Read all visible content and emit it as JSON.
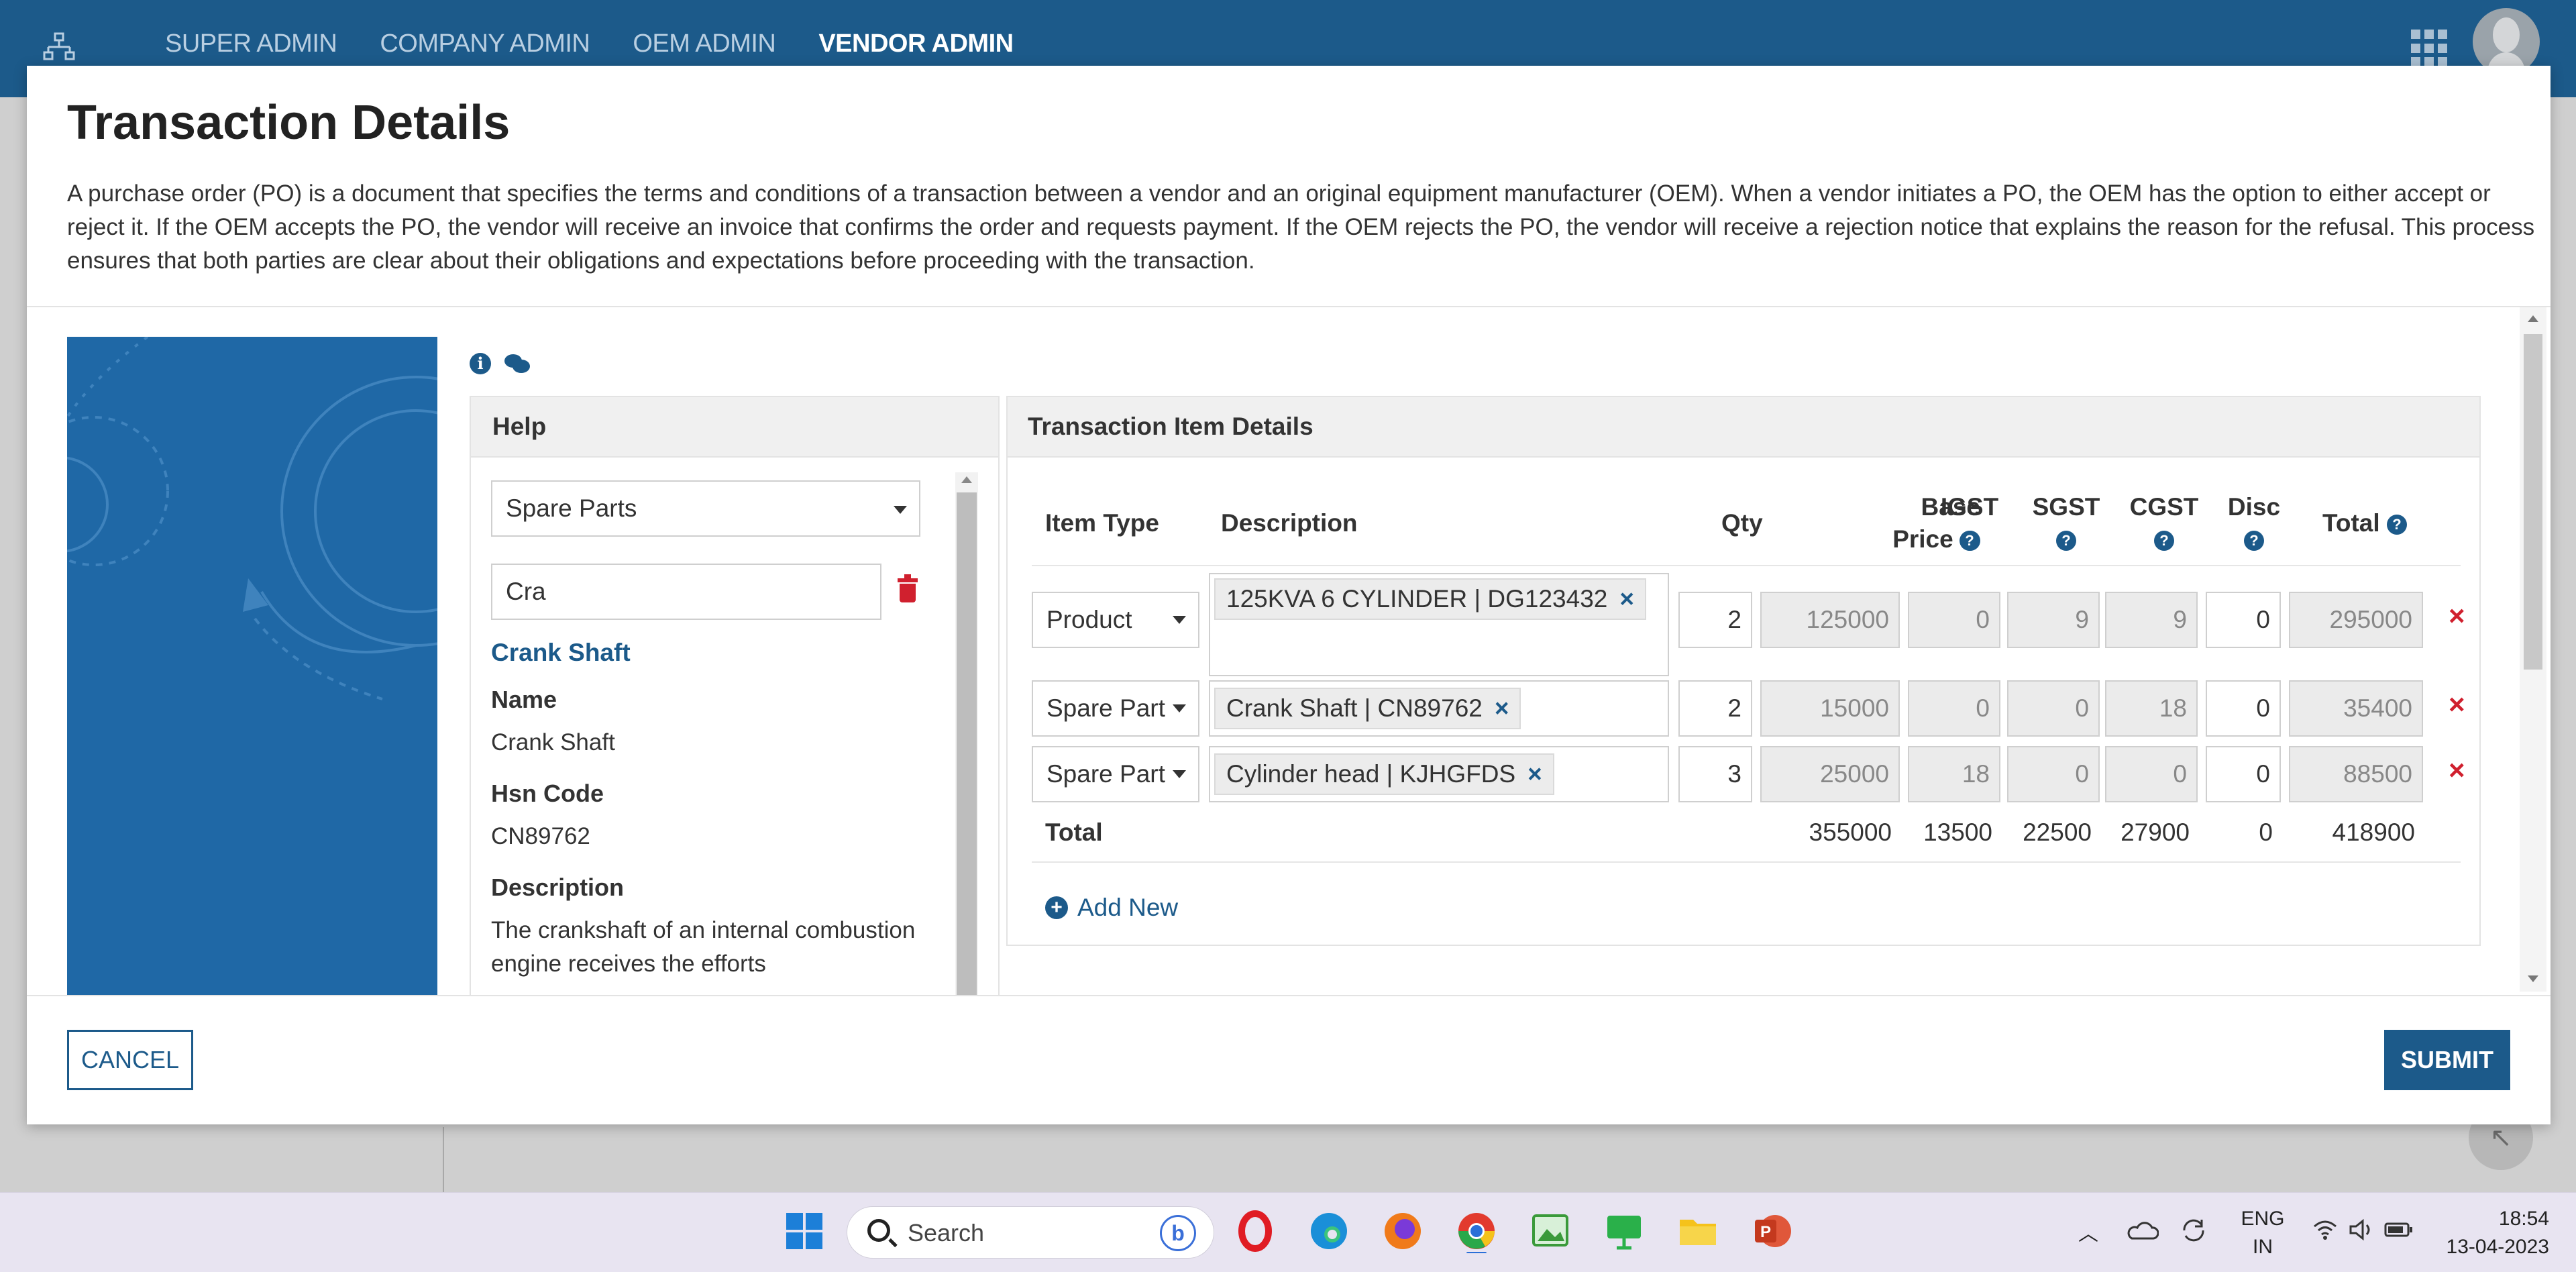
{
  "nav": {
    "items": [
      "SUPER ADMIN",
      "COMPANY ADMIN",
      "OEM ADMIN",
      "VENDOR ADMIN"
    ],
    "active": "VENDOR ADMIN"
  },
  "modal": {
    "title": "Transaction Details",
    "description": "A purchase order (PO) is a document that specifies the terms and conditions of a transaction between a vendor and an original equipment manufacturer (OEM). When a vendor initiates a PO, the OEM has the option to either accept or reject it. If the OEM accepts the PO, the vendor will receive an invoice that confirms the order and requests payment. If the OEM rejects the PO, the vendor will receive a rejection notice that explains the reason for the refusal. This process ensures that both parties are clear about their obligations and expectations before proceeding with the transaction.",
    "cancel_label": "CANCEL",
    "submit_label": "SUBMIT"
  },
  "help": {
    "heading": "Help",
    "category_selected": "Spare Parts",
    "search_value": "Cra",
    "item_title": "Crank Shaft",
    "fields": [
      {
        "label": "Name",
        "value": "Crank Shaft"
      },
      {
        "label": "Hsn Code",
        "value": "CN89762"
      },
      {
        "label": "Description",
        "value": "The crankshaft of an internal combustion engine receives the efforts"
      }
    ]
  },
  "transaction": {
    "heading": "Transaction Item Details",
    "columns": {
      "item_type": "Item Type",
      "description": "Description",
      "qty": "Qty",
      "base_price_1": "Base",
      "base_price_2": "Price",
      "igst": "IGST",
      "sgst": "SGST",
      "cgst": "CGST",
      "disc": "Disc",
      "total": "Total"
    },
    "rows": [
      {
        "type": "Product",
        "desc": "125KVA 6 CYLINDER | DG123432",
        "qty": "2",
        "base_price": "125000",
        "igst": "0",
        "sgst": "9",
        "cgst": "9",
        "disc": "0",
        "total": "295000"
      },
      {
        "type": "Spare Part",
        "desc": "Crank Shaft | CN89762",
        "qty": "2",
        "base_price": "15000",
        "igst": "0",
        "sgst": "0",
        "cgst": "18",
        "disc": "0",
        "total": "35400"
      },
      {
        "type": "Spare Part",
        "desc": "Cylinder head | KJHGFDS",
        "qty": "3",
        "base_price": "25000",
        "igst": "18",
        "sgst": "0",
        "cgst": "0",
        "disc": "0",
        "total": "88500"
      }
    ],
    "totals": {
      "label": "Total",
      "base_price": "355000",
      "igst": "13500",
      "sgst": "22500",
      "cgst": "27900",
      "disc": "0",
      "total": "418900"
    },
    "add_new_label": "Add New",
    "remove_glyph": "×"
  },
  "taskbar": {
    "search_placeholder": "Search",
    "lang_line1": "ENG",
    "lang_line2": "IN",
    "time": "18:54",
    "date": "13-04-2023"
  },
  "colors": {
    "brand": "#1c5a8a",
    "danger": "#d0202e",
    "illustration": "#1f68a6"
  }
}
